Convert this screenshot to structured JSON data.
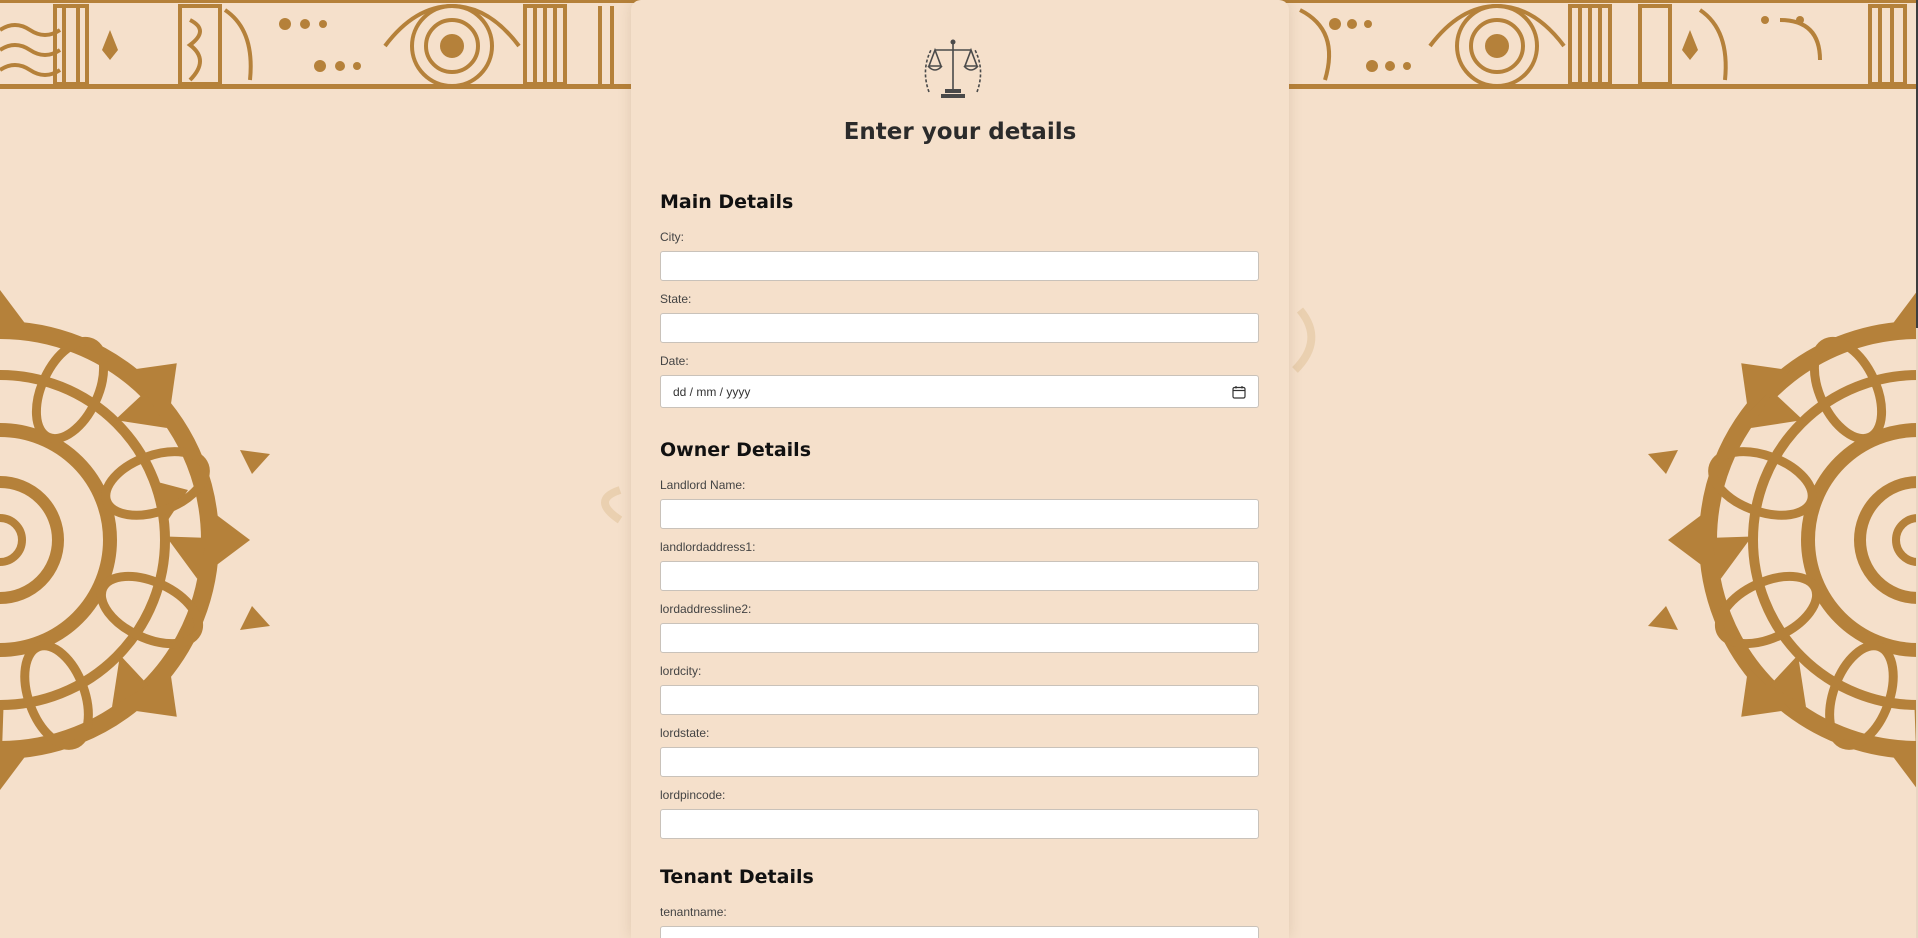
{
  "form": {
    "title": "Enter your details",
    "sections": {
      "main": "Main Details",
      "owner": "Owner Details",
      "tenant": "Tenant Details"
    },
    "labels": {
      "city": "City:",
      "state": "State:",
      "date": "Date:",
      "landlord_name": "Landlord Name:",
      "landlord_address1": "landlordaddress1:",
      "lord_address_line2": "lordaddressline2:",
      "lord_city": "lordcity:",
      "lord_state": "lordstate:",
      "lord_pincode": "lordpincode:",
      "tenant_name": "tenantname:"
    },
    "values": {
      "city": "",
      "state": "",
      "landlord_name": "",
      "landlord_address1": "",
      "lord_address_line2": "",
      "lord_city": "",
      "lord_state": "",
      "lord_pincode": "",
      "tenant_name": ""
    },
    "date_placeholder": "dd / mm / yyyy"
  },
  "icons": {
    "logo": "scales-of-justice-icon",
    "calendar": "calendar-icon"
  },
  "colors": {
    "background": "#f5e0cb",
    "ornament": "#b5813a",
    "ornament_light": "#d7b07a",
    "title_text": "#2b2b2b"
  }
}
